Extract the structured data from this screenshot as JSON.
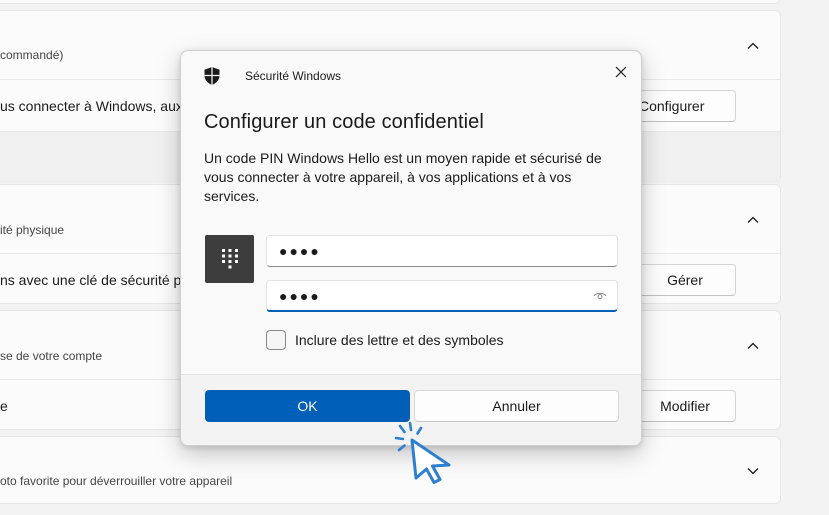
{
  "settings": {
    "sections": [
      {
        "description": "commandé)",
        "row_text": "us connecter à Windows, aux",
        "button_label": "Configurer"
      },
      {
        "description": "ité physique",
        "row_text": "ns avec une clé de sécurité ph",
        "button_label": "Gérer"
      },
      {
        "description": "se de votre compte",
        "row_text": "e",
        "button_label": "Modifier"
      },
      {
        "description": "oto favorite pour déverrouiller votre appareil"
      }
    ]
  },
  "dialog": {
    "app_name": "Sécurité Windows",
    "title": "Configurer un code confidentiel",
    "body": "Un code PIN Windows Hello est un moyen rapide et sécurisé de vous connecter à votre appareil, à vos applications et à vos services.",
    "new_pin_value": "●●●●",
    "confirm_pin_value": "●●●●",
    "checkbox_label": "Inclure des lettre et des symboles",
    "checkbox_checked": false,
    "ok_label": "OK",
    "cancel_label": "Annuler"
  },
  "colors": {
    "accent": "#005fb8",
    "pin_tile": "#3d3d3d",
    "cursor": "#2f7fd0"
  },
  "icons": {
    "shield": "shield-icon",
    "close": "close-icon",
    "pin_pad": "keypad-icon",
    "reveal": "eye-icon",
    "chevron": "chevron-icon",
    "cursor": "mouse-pointer-icon"
  }
}
